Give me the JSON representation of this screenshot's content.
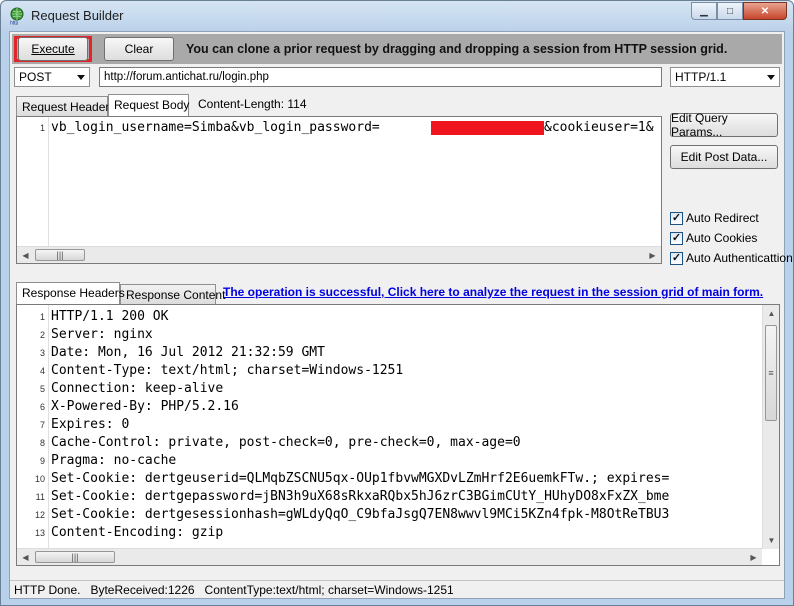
{
  "window": {
    "title": "Request Builder",
    "app_icon": "http-globe-icon"
  },
  "toolbar": {
    "execute_label": "Execute",
    "clear_label": "Clear",
    "hint": "You can clone a prior request by dragging and dropping a session from HTTP session grid."
  },
  "request": {
    "method": "POST",
    "url": "http://forum.antichat.ru/login.php",
    "protocol": "HTTP/1.1",
    "tabs": [
      "Request Headers",
      "Request Body"
    ],
    "active_tab": "Request Body",
    "content_length": "Content-Length: 114",
    "body_lines": [
      {
        "num": "1",
        "text": "vb_login_username=Simba&vb_login_password=",
        "tail": "&cookieuser=1&"
      }
    ]
  },
  "side": {
    "edit_query_params": "Edit Query Params...",
    "edit_post_data": "Edit Post Data...",
    "options": [
      {
        "label": "Auto Redirect",
        "checked": true
      },
      {
        "label": "Auto Cookies",
        "checked": true
      },
      {
        "label": "Auto Authenticattion",
        "checked": true
      }
    ]
  },
  "response": {
    "tabs": [
      "Response Headers",
      "Response Content"
    ],
    "active_tab": "Response Headers",
    "link_text": "The operation is successful, Click here to analyze the request in the session grid of main form.",
    "lines": [
      {
        "num": "1",
        "text": "HTTP/1.1 200 OK"
      },
      {
        "num": "2",
        "text": "Server: nginx"
      },
      {
        "num": "3",
        "text": "Date: Mon, 16 Jul 2012 21:32:59 GMT"
      },
      {
        "num": "4",
        "text": "Content-Type: text/html; charset=Windows-1251"
      },
      {
        "num": "5",
        "text": "Connection: keep-alive"
      },
      {
        "num": "6",
        "text": "X-Powered-By: PHP/5.2.16"
      },
      {
        "num": "7",
        "text": "Expires: 0"
      },
      {
        "num": "8",
        "text": "Cache-Control: private, post-check=0, pre-check=0, max-age=0"
      },
      {
        "num": "9",
        "text": "Pragma: no-cache"
      },
      {
        "num": "10",
        "text": "Set-Cookie: dertgeuserid=QLMqbZSCNU5qx-OUp1fbvwMGXDvLZmHrf2E6uemkFTw.; expires="
      },
      {
        "num": "11",
        "text": "Set-Cookie: dertgepassword=jBN3h9uX68sRkxaRQbx5hJ6zrC3BGimCUtY_HUhyDO8xFxZX_bme"
      },
      {
        "num": "12",
        "text": "Set-Cookie: dertgesessionhash=gWLdyQqO_C9bfaJsgQ7EN8wwvl9MCi5KZn4fpk-M8OtReTBU3"
      },
      {
        "num": "13",
        "text": "Content-Encoding: gzip"
      }
    ]
  },
  "status": {
    "state": "HTTP Done.",
    "bytes": "ByteReceived:1226",
    "content_type": "ContentType:text/html; charset=Windows-1251"
  }
}
